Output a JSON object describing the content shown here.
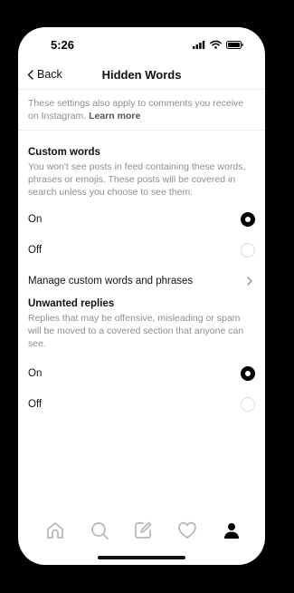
{
  "status_bar": {
    "time": "5:26",
    "icons": [
      "signal-icon",
      "wifi-icon",
      "battery-icon"
    ]
  },
  "nav": {
    "back_label": "Back",
    "title": "Hidden Words"
  },
  "note": {
    "text": "These settings also apply to comments you receive on Instagram.",
    "link": "Learn more"
  },
  "custom_words": {
    "title": "Custom words",
    "description": "You won't see posts in feed containing these words, phrases or emojis. These posts will be covered in search unless you choose to see them.",
    "options": [
      {
        "label": "On",
        "selected": true
      },
      {
        "label": "Off",
        "selected": false
      }
    ],
    "manage_label": "Manage custom words and phrases"
  },
  "unwanted_replies": {
    "title": "Unwanted replies",
    "description": "Replies that may be offensive, misleading or spam will be moved to a covered section that anyone can see.",
    "options": [
      {
        "label": "On",
        "selected": true
      },
      {
        "label": "Off",
        "selected": false
      }
    ]
  },
  "tabbar": {
    "items": [
      "home-icon",
      "search-icon",
      "compose-icon",
      "heart-icon",
      "profile-icon"
    ],
    "active": "profile-icon"
  },
  "colors": {
    "text": "#111111",
    "secondary": "#8e8e8e",
    "divider": "#ececec",
    "inactive_icon": "#b5b5b5"
  }
}
